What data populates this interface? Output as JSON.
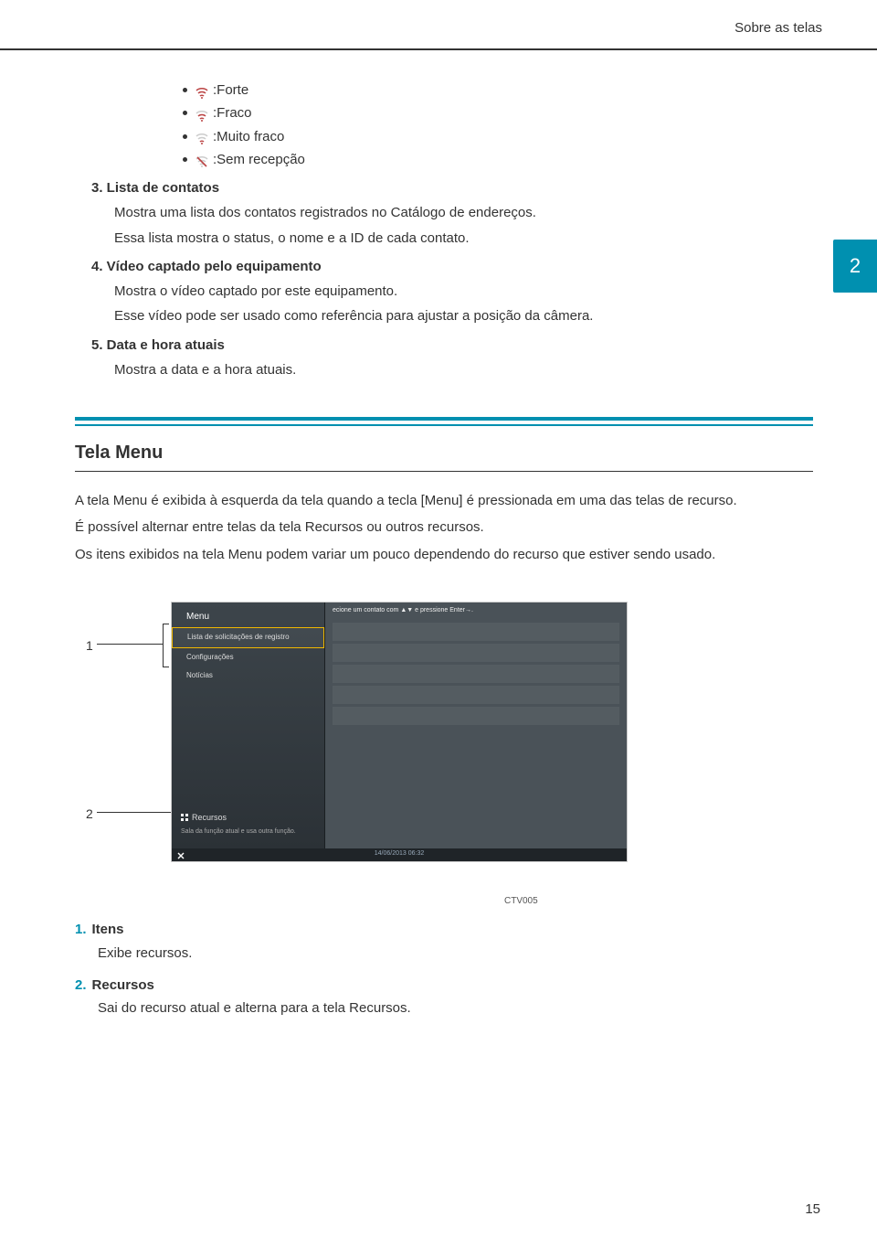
{
  "header": {
    "title": "Sobre as telas"
  },
  "side_tab": "2",
  "signal": {
    "strong": ":Forte",
    "weak": ":Fraco",
    "very_weak": ":Muito fraco",
    "none": ":Sem recepção"
  },
  "items": {
    "n3": {
      "heading": "3. Lista de contatos",
      "p1": "Mostra uma lista dos contatos registrados no Catálogo de endereços.",
      "p2": "Essa lista mostra o status, o nome e a ID de cada contato."
    },
    "n4": {
      "heading": "4. Vídeo captado pelo equipamento",
      "p1": "Mostra o vídeo captado por este equipamento.",
      "p2": "Esse vídeo pode ser usado como referência para ajustar a posição da câmera."
    },
    "n5": {
      "heading": "5. Data e hora atuais",
      "p1": "Mostra a data e a hora atuais."
    }
  },
  "section": {
    "title": "Tela Menu",
    "p1": "A tela Menu é exibida à esquerda da tela quando a tecla [Menu] é pressionada em uma das telas de recurso.",
    "p2": "É possível alternar entre telas da tela Recursos ou outros recursos.",
    "p3": "Os itens exibidos na tela Menu podem variar um pouco dependendo do recurso que estiver sendo usado."
  },
  "screenshot": {
    "menu_title": "Menu",
    "item_hl": "Lista de solicitações de registro",
    "item2": "Configurações",
    "item3": "Notícias",
    "recursos": "Recursos",
    "recursos_sub": "Sala da função atual e usa outra função.",
    "topbar": "ecione um contato com ▲▼ e pressione Enter→.",
    "time": "14/06/2013 06:32",
    "callout1": "1",
    "callout2": "2",
    "code": "CTV005"
  },
  "legend": {
    "n1": {
      "num": "1.",
      "title": "Itens",
      "desc": "Exibe recursos."
    },
    "n2": {
      "num": "2.",
      "title": "Recursos",
      "desc": "Sai do recurso atual e alterna para a tela Recursos."
    }
  },
  "footer": {
    "page": "15"
  }
}
